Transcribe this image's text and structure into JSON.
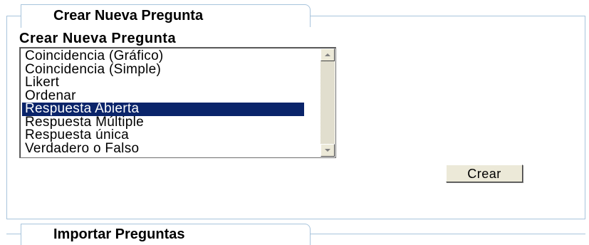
{
  "panel": {
    "tab_title": "Crear Nueva Pregunta",
    "section_label": "Crear Nueva Pregunta"
  },
  "question_types": {
    "options": [
      "Coincidencia (Gráfico)",
      "Coincidencia (Simple)",
      "Likert",
      "Ordenar",
      "Respuesta Abierta",
      "Respuesta Múltiple",
      "Respuesta única",
      "Verdadero o Falso"
    ],
    "selected": "Respuesta Abierta"
  },
  "create_button_label": "Crear",
  "import_panel": {
    "tab_title": "Importar Preguntas"
  },
  "colors": {
    "panel_border": "#a8c4dc",
    "selection": "#0a246a"
  }
}
